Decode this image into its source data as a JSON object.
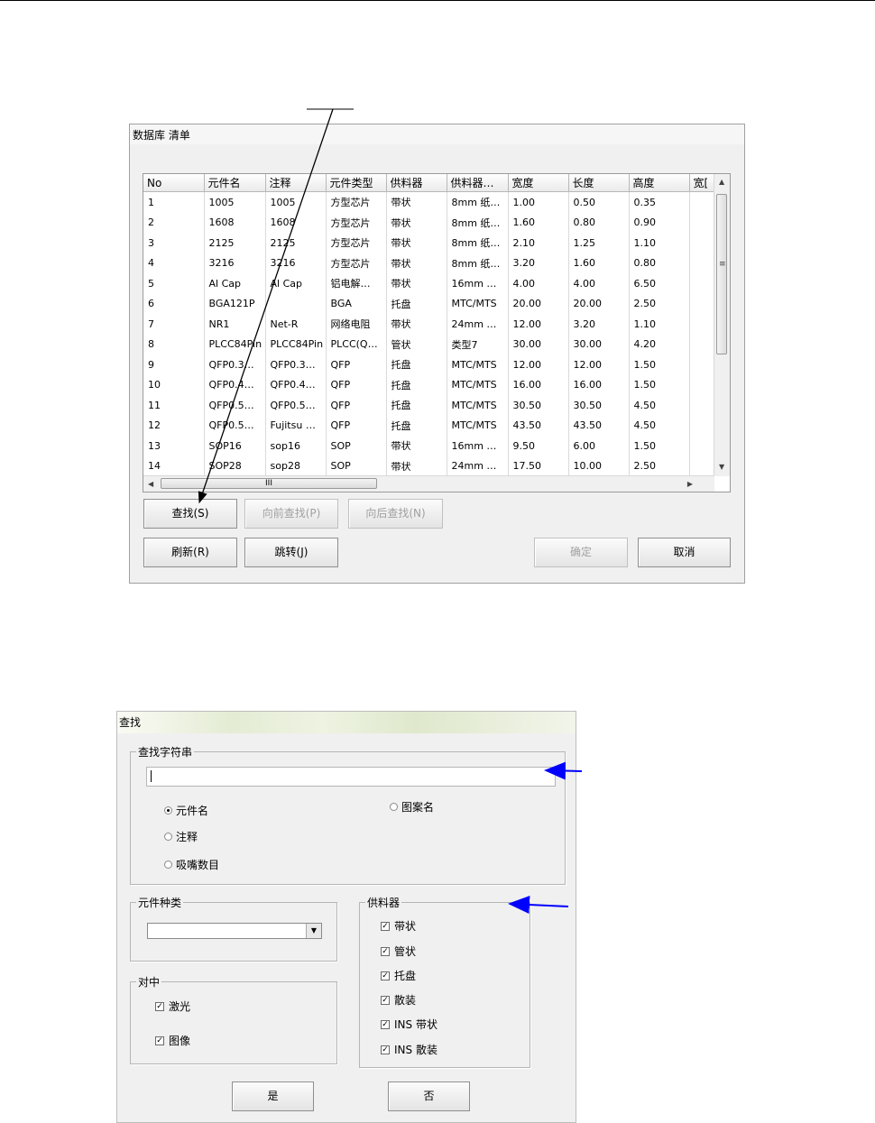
{
  "list_dialog": {
    "title": "数据库 清单",
    "columns": [
      "No",
      "元件名",
      "注释",
      "元件类型",
      "供料器",
      "供料器…",
      "宽度",
      "长度",
      "高度",
      "宽["
    ],
    "rows": [
      [
        "1",
        "1005",
        "1005",
        "方型芯片",
        "带状",
        "8mm 纸…",
        "1.00",
        "0.50",
        "0.35",
        ""
      ],
      [
        "2",
        "1608",
        "1608",
        "方型芯片",
        "带状",
        "8mm 纸…",
        "1.60",
        "0.80",
        "0.90",
        ""
      ],
      [
        "3",
        "2125",
        "2125",
        "方型芯片",
        "带状",
        "8mm 纸…",
        "2.10",
        "1.25",
        "1.10",
        ""
      ],
      [
        "4",
        "3216",
        "3216",
        "方型芯片",
        "带状",
        "8mm 纸…",
        "3.20",
        "1.60",
        "0.80",
        ""
      ],
      [
        "5",
        "Al Cap",
        "Al Cap",
        "铝电解…",
        "带状",
        "16mm …",
        "4.00",
        "4.00",
        "6.50",
        ""
      ],
      [
        "6",
        "BGA121P",
        "",
        "BGA",
        "托盘",
        "MTC/MTS",
        "20.00",
        "20.00",
        "2.50",
        ""
      ],
      [
        "7",
        "NR1",
        "Net-R",
        "网络电阻",
        "带状",
        "24mm …",
        "12.00",
        "3.20",
        "1.10",
        ""
      ],
      [
        "8",
        "PLCC84Pin",
        "PLCC84Pin",
        "PLCC(Q…",
        "管状",
        "类型7",
        "30.00",
        "30.00",
        "4.20",
        ""
      ],
      [
        "9",
        "QFP0.3…",
        "QFP0.3…",
        "QFP",
        "托盘",
        "MTC/MTS",
        "12.00",
        "12.00",
        "1.50",
        ""
      ],
      [
        "10",
        "QFP0.4…",
        "QFP0.4…",
        "QFP",
        "托盘",
        "MTC/MTS",
        "16.00",
        "16.00",
        "1.50",
        ""
      ],
      [
        "11",
        "QFP0.5…",
        "QFP0.5…",
        "QFP",
        "托盘",
        "MTC/MTS",
        "30.50",
        "30.50",
        "4.50",
        ""
      ],
      [
        "12",
        "QFP0.5…",
        "Fujitsu …",
        "QFP",
        "托盘",
        "MTC/MTS",
        "43.50",
        "43.50",
        "4.50",
        ""
      ],
      [
        "13",
        "SOP16",
        "sop16",
        "SOP",
        "带状",
        "16mm …",
        "9.50",
        "6.00",
        "1.50",
        ""
      ],
      [
        "14",
        "SOP28",
        "sop28",
        "SOP",
        "带状",
        "24mm …",
        "17.50",
        "10.00",
        "2.50",
        ""
      ]
    ],
    "hscroll_grip": "III",
    "buttons": {
      "find": "查找(S)",
      "find_prev": "向前查找(P)",
      "find_next": "向后查找(N)",
      "refresh": "刷新(R)",
      "jump": "跳转(J)",
      "ok": "确定",
      "cancel": "取消"
    }
  },
  "find_dialog": {
    "title": "查找",
    "search_group": "查找字符串",
    "search_value": "",
    "radio_part_name": "元件名",
    "radio_pattern_name": "图案名",
    "radio_comment": "注释",
    "radio_nozzle_count": "吸嘴数目",
    "part_type_group": "元件种类",
    "part_type_value": "",
    "centering_group": "对中",
    "laser": "激光",
    "image": "图像",
    "feeder_group": "供料器",
    "feeders": [
      "带状",
      "管状",
      "托盘",
      "散装",
      "INS 带状",
      "INS 散装"
    ],
    "yes": "是",
    "no": "否"
  },
  "colors": {
    "annotation_arrow": "#0000ff",
    "pointer_line": "#000000"
  }
}
